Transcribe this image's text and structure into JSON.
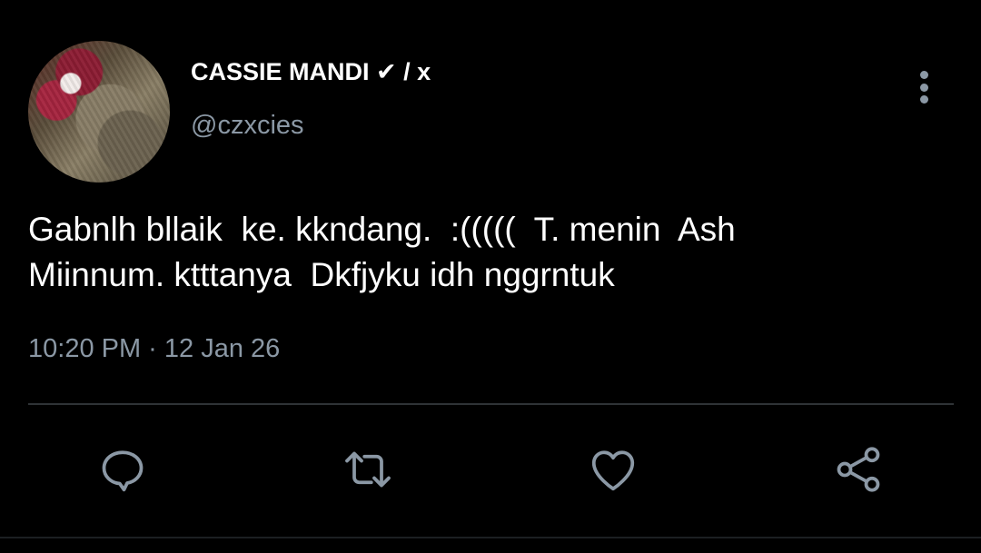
{
  "tweet": {
    "display_name": "CASSIE MANDI ✔ / x",
    "handle": "@czxcies",
    "text": "Gabnlh bllaik  ke. kkndang.  :(((((  T. menin  Ash\nMiinnum. ktttanya  Dkfjyku idh nggrntuk",
    "timestamp": "10:20 PM · 12 Jan 26"
  },
  "actions": {
    "reply_icon": "reply-icon",
    "retweet_icon": "retweet-icon",
    "like_icon": "heart-icon",
    "share_icon": "share-icon",
    "more_icon": "more-vertical-icon"
  },
  "colors": {
    "background": "#000000",
    "primary_text": "#ffffff",
    "secondary_text": "#8b98a5",
    "divider": "#2f3336"
  }
}
